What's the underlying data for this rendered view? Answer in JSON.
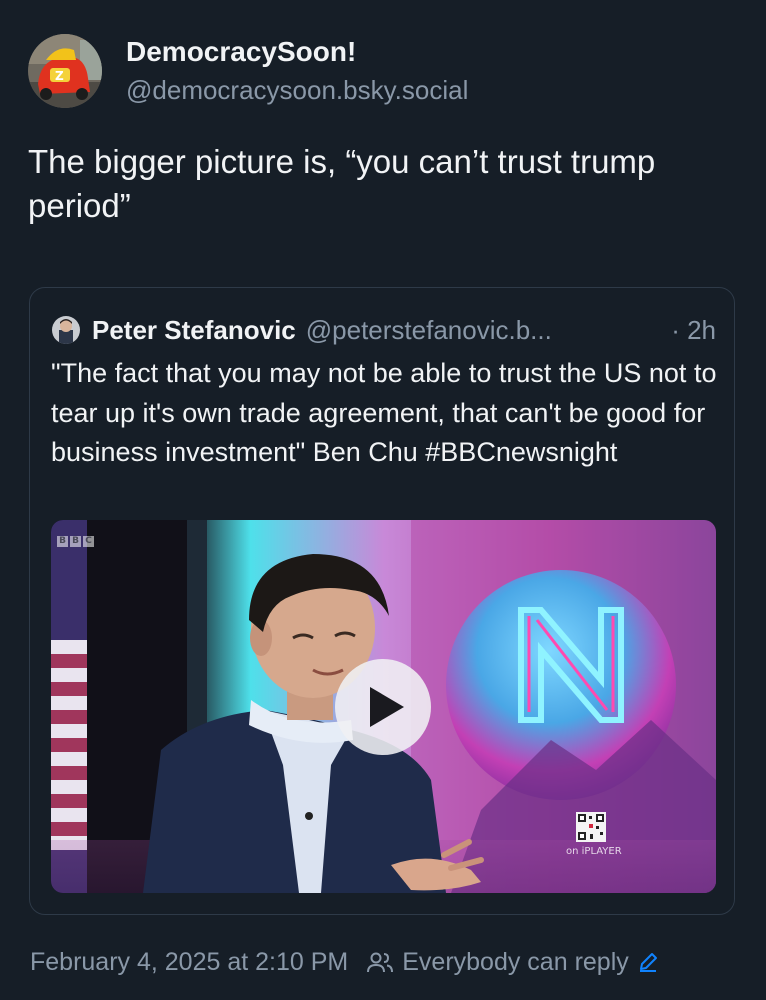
{
  "post": {
    "author": {
      "display_name": "DemocracySoon!",
      "handle": "@democracysoon.bsky.social",
      "avatar_icon": "avatar-toy-car"
    },
    "text": "The bigger picture is, “you can’t trust trump period”",
    "quote": {
      "author_name": "Peter Stefanovic",
      "author_handle": "@peterstefanovic.b...",
      "time": "· 2h",
      "text": "\"The fact that you may not be able to trust the US not to tear up it's own trade agreement, that can't be good for business investment\" Ben Chu #BBCnewsnight",
      "video": {
        "play_icon": "play-icon",
        "channel_logo": [
          "B",
          "B",
          "C"
        ],
        "corner_text": "on iPLAYER"
      }
    },
    "footer": {
      "timestamp": "February 4, 2025 at 2:10 PM",
      "reply_setting": "Everybody can reply",
      "reply_icon": "people-icon",
      "edit_icon": "pencil-icon"
    }
  },
  "colors": {
    "background": "#161e27",
    "text_primary": "#f1f3f5",
    "text_secondary": "#8a98a8",
    "border": "#2e3a48",
    "accent": "#1083fe"
  }
}
